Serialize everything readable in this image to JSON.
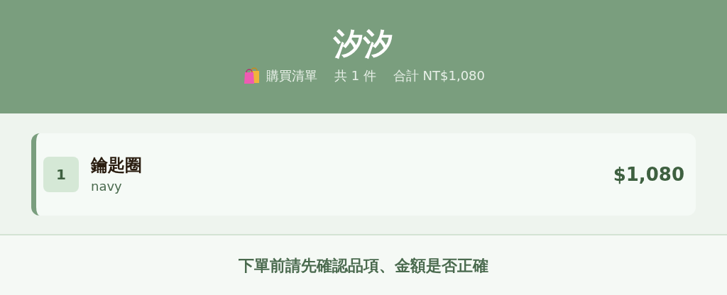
{
  "header": {
    "title": "汐汐",
    "list_label": "購買清單",
    "count": "共 1 件",
    "total": "合計 NT$1,080"
  },
  "items": [
    {
      "index": "1",
      "name": "鑰匙圈",
      "variant": "navy",
      "price": "$1,080"
    }
  ],
  "footer": {
    "notice": "下單前請先確認品項、金額是否正確"
  }
}
